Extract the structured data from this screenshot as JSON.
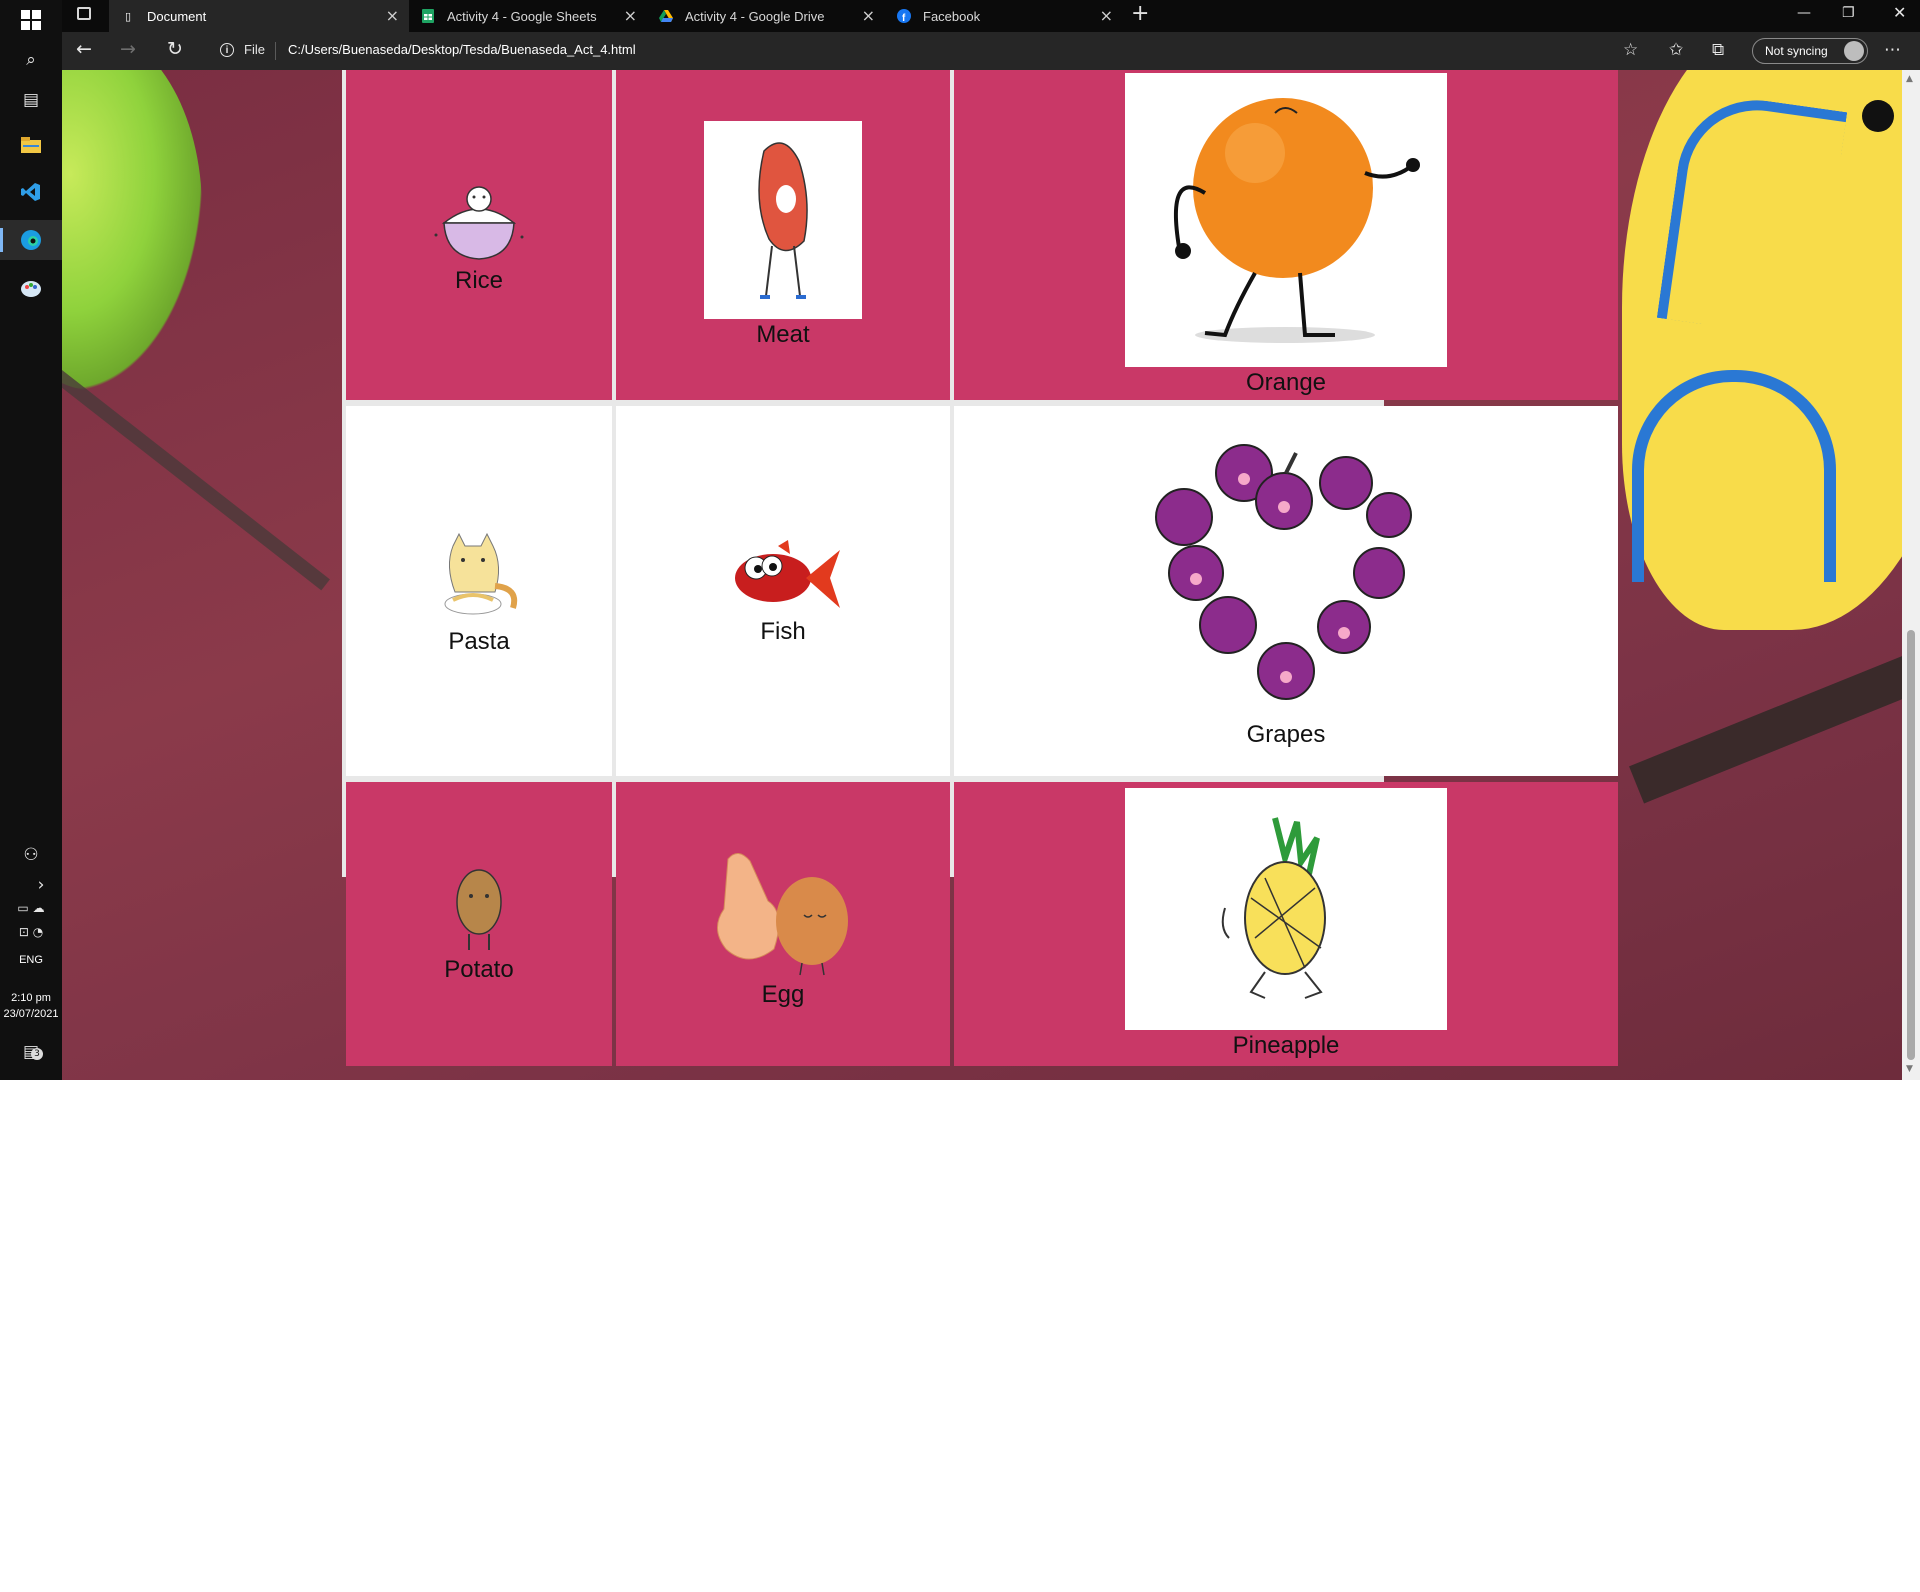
{
  "browser": {
    "tabs": [
      {
        "title": "Document",
        "icon": "document-icon"
      },
      {
        "title": "Activity 4 - Google Sheets",
        "icon": "sheets-icon"
      },
      {
        "title": "Activity 4 - Google Drive",
        "icon": "drive-icon"
      },
      {
        "title": "Facebook",
        "icon": "facebook-icon"
      }
    ],
    "file_label": "File",
    "url": "C:/Users/Buenaseda/Desktop/Tesda/Buenaseda_Act_4.html",
    "sync_label": "Not syncing"
  },
  "taskbar": {
    "language": "ENG",
    "time": "2:10 pm",
    "date": "23/07/2021",
    "notification_count": "3"
  },
  "foods": [
    {
      "name": "Rice",
      "row": 1,
      "color": "#c93867"
    },
    {
      "name": "Meat",
      "row": 1,
      "color": "#c93867"
    },
    {
      "name": "Orange",
      "row": 1,
      "color": "#c93867"
    },
    {
      "name": "Pasta",
      "row": 2,
      "color": "#ffffff"
    },
    {
      "name": "Fish",
      "row": 2,
      "color": "#ffffff"
    },
    {
      "name": "Grapes",
      "row": 2,
      "color": "#ffffff"
    },
    {
      "name": "Potato",
      "row": 3,
      "color": "#c93867"
    },
    {
      "name": "Egg",
      "row": 3,
      "color": "#c93867"
    },
    {
      "name": "Pineapple",
      "row": 3,
      "color": "#c93867"
    }
  ]
}
